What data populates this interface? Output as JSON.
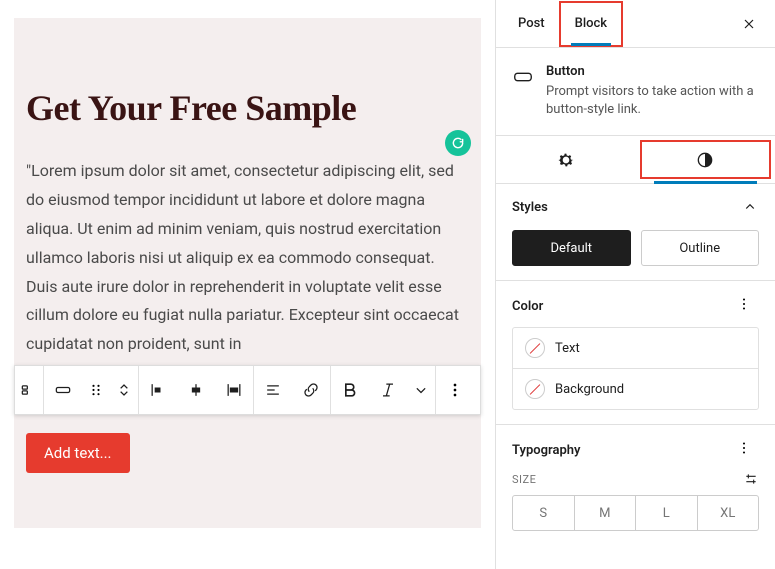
{
  "editor": {
    "heading": "Get Your Free Sample",
    "paragraph": "\"Lorem ipsum dolor sit amet, consectetur adipiscing elit, sed do eiusmod tempor incididunt ut labore et dolore magna aliqua. Ut enim ad minim veniam, quis nostrud exercitation ullamco laboris nisi ut aliquip ex ea commodo consequat. Duis aute irure dolor in reprehenderit in voluptate velit esse cillum dolore eu fugiat nulla pariatur. Excepteur sint occaecat cupidatat non proident, sunt in",
    "button_placeholder": "Add text..."
  },
  "sidebar": {
    "tabs": {
      "post": "Post",
      "block": "Block"
    },
    "block": {
      "name": "Button",
      "description": "Prompt visitors to take action with a button-style link."
    },
    "panels": {
      "styles": {
        "title": "Styles",
        "default": "Default",
        "outline": "Outline"
      },
      "color": {
        "title": "Color",
        "text": "Text",
        "background": "Background"
      },
      "typography": {
        "title": "Typography",
        "size_label": "SIZE",
        "sizes": [
          "S",
          "M",
          "L",
          "XL"
        ]
      }
    }
  }
}
